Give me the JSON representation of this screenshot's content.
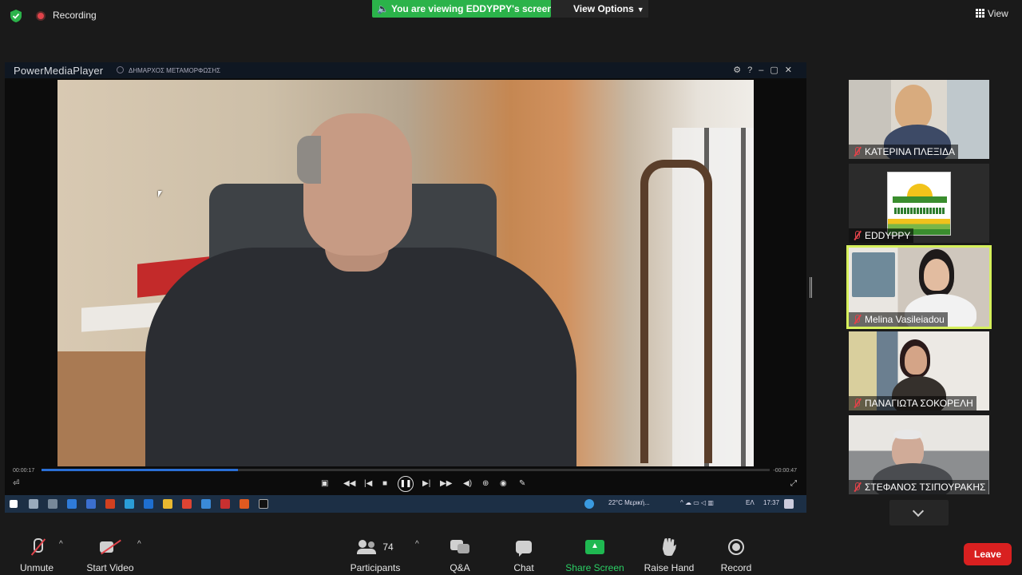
{
  "topbar": {
    "recording_label": "Recording",
    "viewing_banner": "You are viewing EDDYPPY's screen",
    "view_options_label": "View Options",
    "view_label": "View"
  },
  "shared_screen": {
    "player_name": "PowerMediaPlayer",
    "file_title": "ΔΗΜΑΡΧΟΣ ΜΕΤΑΜΟΡΦΩΣΗΣ",
    "time_elapsed": "00:00:17",
    "time_remaining": "-00:00:47",
    "progress_fraction": 0.27,
    "taskbar": {
      "weather": "22°C  Μερική...",
      "language": "ΕΛ",
      "clock": "17:37"
    }
  },
  "gallery": {
    "participants": [
      {
        "name": "ΚΑΤΕΡΙΝΑ ΠΛΕΞΙΔΑ",
        "muted": true,
        "active": false
      },
      {
        "name": "EDDYPPY",
        "muted": true,
        "active": false
      },
      {
        "name": "Melina Vasileiadou",
        "muted": true,
        "active": true
      },
      {
        "name": "ΠΑΝΑΓΙΩΤΑ ΣΟΚΟΡΕΛΗ",
        "muted": true,
        "active": false
      },
      {
        "name": "ΣΤΕΦΑΝΟΣ ΤΣΙΠΟΥΡΑΚΗΣ",
        "muted": true,
        "active": false
      }
    ]
  },
  "toolbar": {
    "unmute_label": "Unmute",
    "start_video_label": "Start Video",
    "participants_label": "Participants",
    "participants_count": "74",
    "qa_label": "Q&A",
    "chat_label": "Chat",
    "share_screen_label": "Share Screen",
    "raise_hand_label": "Raise Hand",
    "record_label": "Record",
    "leave_label": "Leave"
  },
  "colors": {
    "banner_green": "#2bb34a",
    "share_green": "#2bd065",
    "leave_red": "#d92020",
    "mute_red": "#e0434a",
    "active_speaker": "#d6f05c"
  }
}
